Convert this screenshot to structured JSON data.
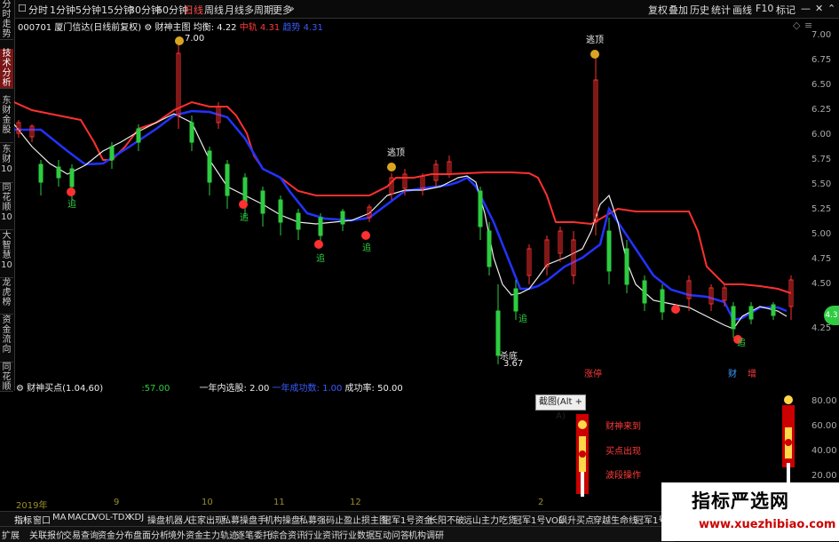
{
  "toolbar": {
    "periods": [
      "分时",
      "1分钟",
      "5分钟",
      "15分钟",
      "30分钟",
      "60分钟",
      "日线",
      "周线",
      "月线",
      "多周期",
      "更多"
    ],
    "active_period": "日线",
    "right_buttons": [
      "复权",
      "叠加",
      "历史",
      "统计",
      "画线",
      "F10",
      "标记"
    ]
  },
  "left_tabs": [
    "分时走势",
    "技术分析",
    "东财金股",
    "东财10",
    "同花顺10",
    "大智慧10",
    "龙虎榜",
    "资金流向",
    "同花顺"
  ],
  "left_tabs_active": "技术分析",
  "main_header": {
    "code": "000701",
    "name": "厦门信达(日线前复权)",
    "indicator": "财神主图",
    "junheng_label": "均衡:",
    "junheng_value": "4.22",
    "zhongxian_label": "中轨",
    "zhongxian_value": "4.31",
    "third_label": "趋势",
    "third_value": "4.31"
  },
  "price_axis": [
    "7.00",
    "6.75",
    "6.50",
    "6.25",
    "6.00",
    "5.75",
    "5.50",
    "5.25",
    "5.00",
    "4.75",
    "4.50",
    "4.25"
  ],
  "price_marker": "4.3",
  "annotations": {
    "high_label": "7.00",
    "low_label": "3.67",
    "taoding": "逃顶",
    "shadi": "杀底",
    "top_label2": "逃顶",
    "zhui": "追",
    "zhangting": "涨停",
    "cai": "财",
    "zeng": "增"
  },
  "indicator_header": {
    "name": "财神买点(1.04,60)",
    "val1": ":57.00",
    "label_xuangu": "一年内选股:",
    "val_xuangu": "2.00",
    "label_chenggong": "一年成功数:",
    "val_chenggong": "1.00",
    "label_rate": "成功率:",
    "val_rate": "50.00"
  },
  "indicator_axis": [
    "80.00",
    "60.00",
    "40.00",
    "20.00"
  ],
  "indicator_signals": [
    "财神来到",
    "买点出现",
    "波段操作"
  ],
  "tooltip": "截图(Alt + A)",
  "xaxis": [
    "2019年",
    "9",
    "10",
    "11",
    "12",
    "2"
  ],
  "bottom_tabs_row1": [
    "指标",
    "窗口",
    "MA",
    "MACD",
    "VOL-TDX",
    "KDJ",
    "操盘机器人",
    "庄家出现",
    "私募操盘手",
    "机构操盘",
    "私募强码",
    "止盈止损主图",
    "冠军1号资金",
    "长阳不破",
    "远山主力吃货",
    "冠军1号VOL",
    "飙升买点",
    "穿越生命线",
    "冠军1号"
  ],
  "bottom_tabs_row1_active": "指标",
  "bottom_tabs_row2": [
    "扩展",
    "关联报价",
    "交易查询",
    "资金分布",
    "盘面分析",
    "境外资金",
    "主力轨迹",
    "逐笔委托",
    "综合资讯",
    "行业资讯",
    "行业数据",
    "互动问答",
    "机构调研"
  ],
  "watermark": {
    "title": "指标严选网",
    "url": "www.xuezhibiao.com"
  },
  "colors": {
    "red": "#ff3030",
    "blue": "#2233ff",
    "green": "#2ecc40",
    "white": "#eeeeee",
    "bg": "#000000"
  }
}
